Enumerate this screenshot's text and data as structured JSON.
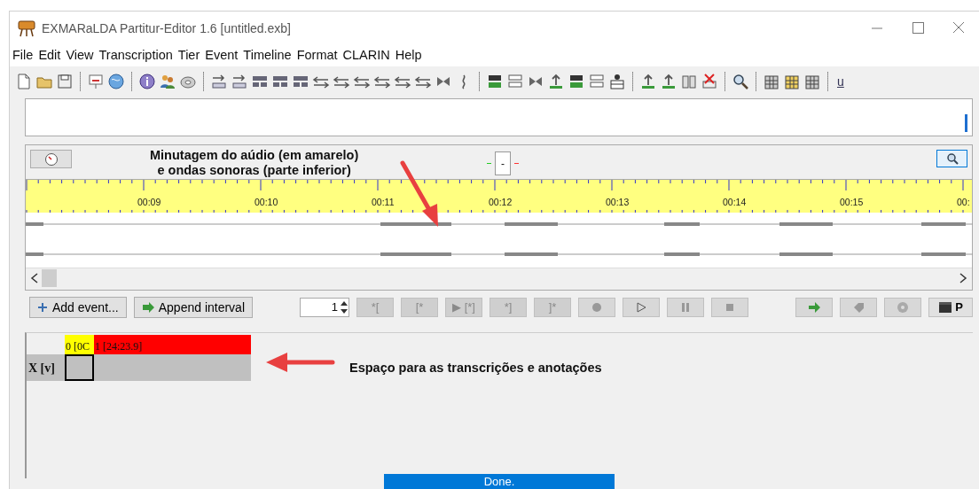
{
  "window": {
    "title": "EXMARaLDA Partitur-Editor 1.6 [untitled.exb]"
  },
  "menu": [
    "File",
    "Edit",
    "View",
    "Transcription",
    "Tier",
    "Event",
    "Timeline",
    "Format",
    "CLARIN",
    "Help"
  ],
  "toolbar": {
    "text_buttons": [
      "u"
    ]
  },
  "timeline_view": {
    "annotation": "Minutagem do aúdio (em amarelo)\ne ondas sonoras (parte inferior)",
    "readout": "-",
    "markers": [
      {
        "color": "#22cc22"
      },
      {
        "color": "#ff3333"
      }
    ],
    "ticks": [
      "00:09",
      "00:10",
      "00:11",
      "00:12",
      "00:13",
      "00:14",
      "00:15",
      "00:"
    ]
  },
  "controls": {
    "add_event": "Add event...",
    "append_interval": "Append interval",
    "spinner": {
      "value": "1"
    },
    "selection_buttons": [
      {
        "label": "*[",
        "disabled": true
      },
      {
        "label": "[*",
        "disabled": true
      },
      {
        "label": "▶ [*]",
        "disabled": true
      },
      {
        "label": "*]",
        "disabled": true
      },
      {
        "label": "]*",
        "disabled": true
      }
    ],
    "panel_button": {
      "label": "P"
    }
  },
  "partitur": {
    "timeline_cells": [
      {
        "label": "0 [0C",
        "color": "#ffff00"
      },
      {
        "label": "1 [24:23.9]",
        "color": "#ff0000"
      }
    ],
    "tiers": [
      {
        "label": "X [v]"
      }
    ],
    "annotation": "Espaço para as transcrições e anotações"
  },
  "status_bar": {
    "text": "Done."
  }
}
